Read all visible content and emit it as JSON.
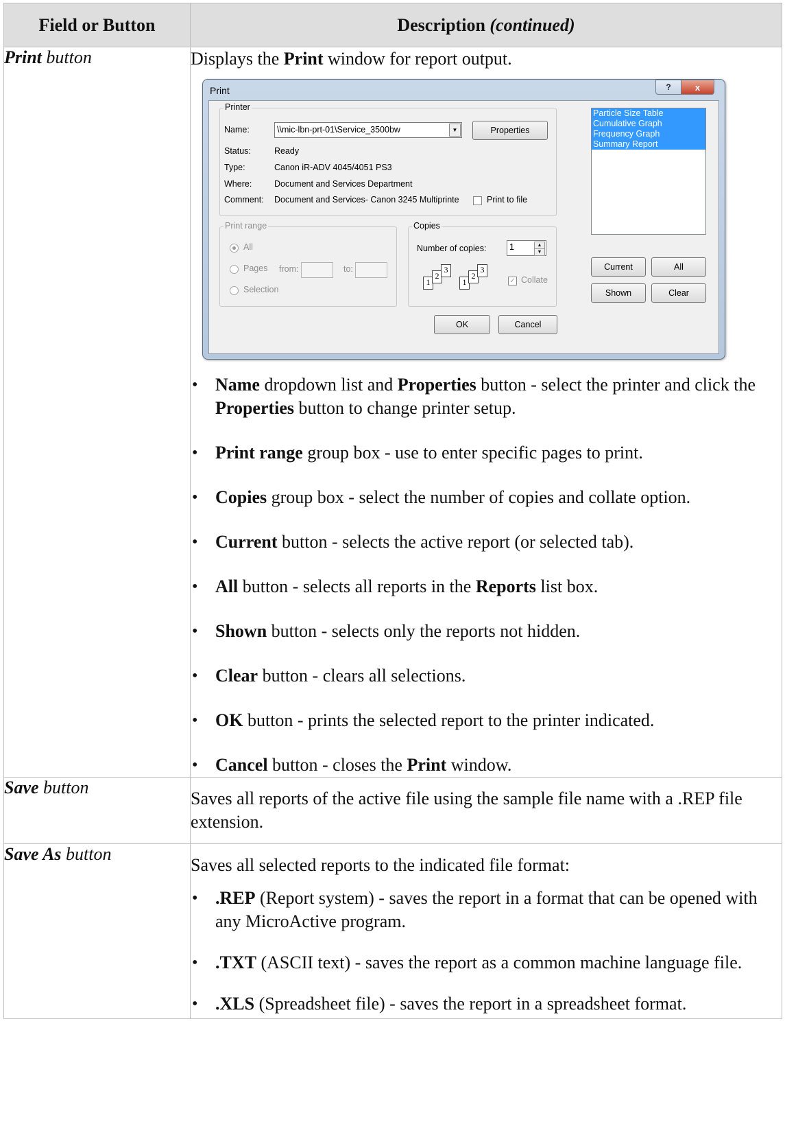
{
  "header": {
    "col1": "Field or Button",
    "col2_main": "Description",
    "col2_note": "(continued)"
  },
  "rows": {
    "print": {
      "field_bold": "Print",
      "field_rest": " button",
      "lead_pre": "Displays the ",
      "lead_bold": "Print",
      "lead_post": " window for report output.",
      "bullets": [
        {
          "b1": "Name",
          "t1": " dropdown list and ",
          "b2": "Properties",
          "t2": " button - select the printer and click the ",
          "b3": "Properties",
          "t3": " button to change printer setup."
        },
        {
          "b1": "Print range",
          "t1": " group box - use to enter specific pages to print."
        },
        {
          "b1": "Copies",
          "t1": " group box - select the number of copies and collate option."
        },
        {
          "b1": "Current",
          "t1": " button - selects the active report (or selected tab)."
        },
        {
          "b1": "All",
          "t1": " button - selects all reports in the ",
          "b2": "Reports",
          "t2": " list box."
        },
        {
          "b1": "Shown",
          "t1": " button - selects only the reports not hidden."
        },
        {
          "b1": "Clear",
          "t1": " button - clears all selections."
        },
        {
          "b1": "OK",
          "t1": " button - prints the selected report to the printer indicated."
        },
        {
          "b1": "Cancel",
          "t1": " button - closes the ",
          "b2": "Print",
          "t2": " window."
        }
      ]
    },
    "save": {
      "field_bold": "Save",
      "field_rest": " button",
      "desc": "Saves all reports of the active file using the sample file name with a .REP file extension."
    },
    "save_as": {
      "field_bold": "Save As",
      "field_rest": " button",
      "lead": "Saves all selected reports to the indicated file format:",
      "bullets": [
        {
          "b1": ".REP",
          "t1": " (Report system) - saves the report in a format that can be opened with any MicroActive program."
        },
        {
          "b1": ".TXT",
          "t1": " (ASCII text) - saves the report as a common machine language file."
        },
        {
          "b1": ".XLS",
          "t1": " (Spreadsheet file) - saves the report in a spreadsheet format."
        }
      ]
    }
  },
  "dialog": {
    "title": "Print",
    "help_glyph": "?",
    "close_glyph": "x",
    "printer_group": "Printer",
    "name_label": "Name:",
    "name_value": "\\\\mic-lbn-prt-01\\Service_3500bw",
    "properties_btn": "Properties",
    "status_label": "Status:",
    "status_value": "Ready",
    "type_label": "Type:",
    "type_value": "Canon iR-ADV 4045/4051 PS3",
    "where_label": "Where:",
    "where_value": "Document and Services Department",
    "comment_label": "Comment:",
    "comment_value": "Document and Services- Canon 3245 Multiprinte",
    "print_to_file": "Print to file",
    "range_group": "Print range",
    "range_all": "All",
    "range_pages": "Pages",
    "range_from": "from:",
    "range_to": "to:",
    "range_selection": "Selection",
    "copies_group": "Copies",
    "copies_label": "Number of copies:",
    "copies_value": "1",
    "collate": "Collate",
    "collate_pages": [
      "1",
      "2",
      "3"
    ],
    "reports": [
      "Particle Size Table",
      "Cumulative Graph",
      "Frequency Graph",
      "Summary Report"
    ],
    "current_btn": "Current",
    "all_btn": "All",
    "shown_btn": "Shown",
    "clear_btn": "Clear",
    "ok_btn": "OK",
    "cancel_btn": "Cancel"
  }
}
